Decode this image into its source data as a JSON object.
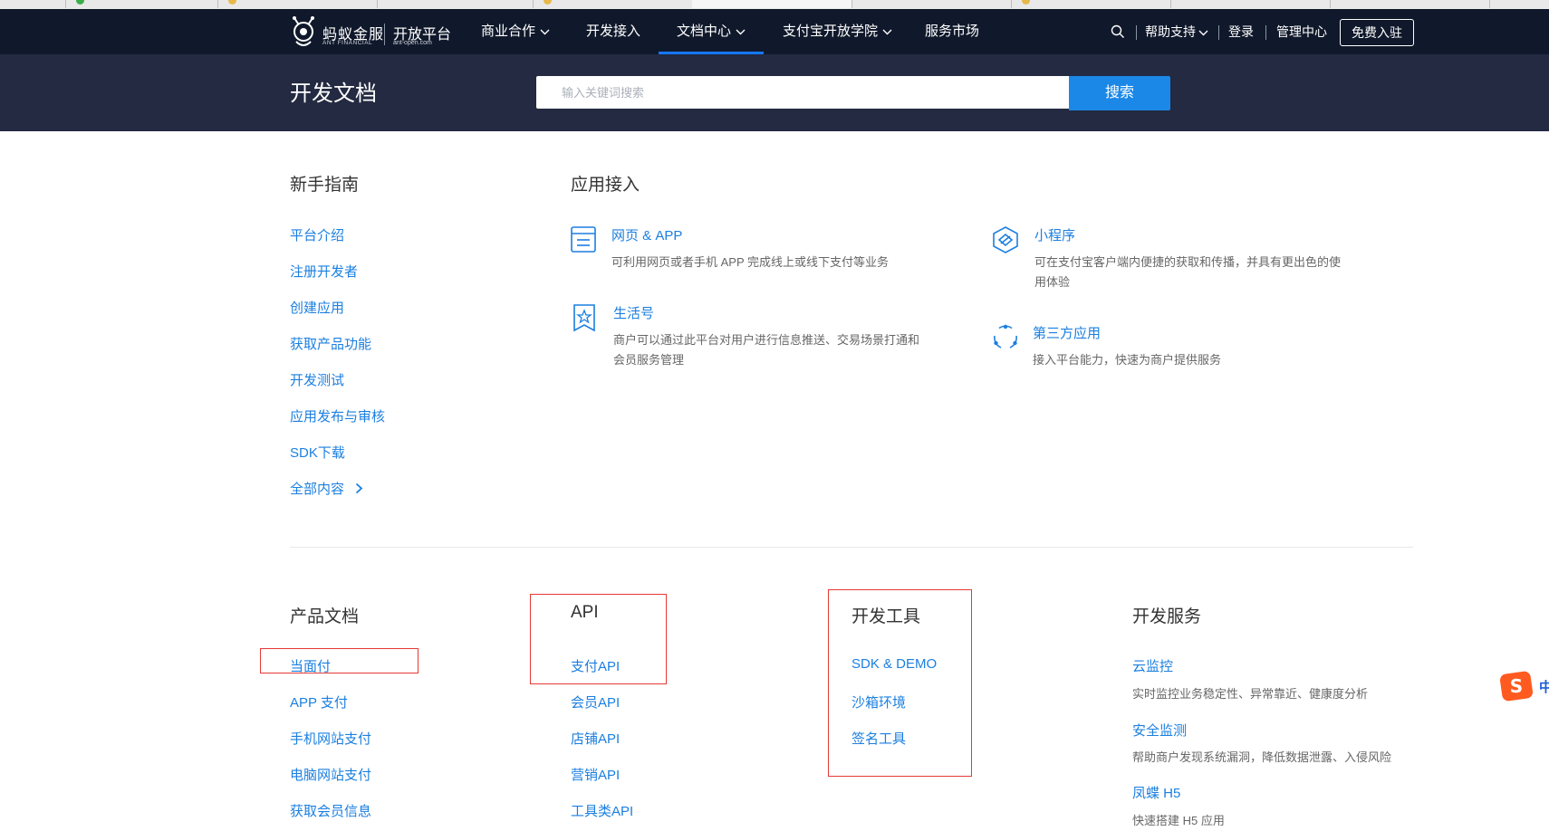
{
  "nav": {
    "brand": "蚂蚁金服",
    "brand_sub": "ANT FINANCIAL",
    "platform": "开放平台",
    "platform_sub": "ant-open.com",
    "items": [
      {
        "label": "商业合作",
        "chevron": true
      },
      {
        "label": "开发接入",
        "chevron": false
      },
      {
        "label": "文档中心",
        "chevron": true,
        "active": true
      },
      {
        "label": "支付宝开放学院",
        "chevron": true
      },
      {
        "label": "服务市场",
        "chevron": false
      }
    ],
    "help": "帮助支持",
    "login": "登录",
    "admin": "管理中心",
    "join": "免费入驻"
  },
  "hero": {
    "title": "开发文档",
    "search_placeholder": "输入关键词搜索",
    "search_button": "搜索"
  },
  "guide": {
    "title": "新手指南",
    "links": [
      "平台介绍",
      "注册开发者",
      "创建应用",
      "获取产品功能",
      "开发测试",
      "应用发布与审核",
      "SDK下载",
      "全部内容"
    ]
  },
  "app_access": {
    "title": "应用接入",
    "cards": [
      {
        "icon": "browser-window-icon",
        "title": "网页 & APP",
        "desc": "可利用网页或者手机 APP 完成线上或线下支付等业务"
      },
      {
        "icon": "mini-program-icon",
        "title": "小程序",
        "desc": "可在支付宝客户端内便捷的获取和传播，并具有更出色的使用体验"
      },
      {
        "icon": "star-bookmark-icon",
        "title": "生活号",
        "desc": "商户可以通过此平台对用户进行信息推送、交易场景打通和会员服务管理"
      },
      {
        "icon": "third-party-icon",
        "title": "第三方应用",
        "desc": "接入平台能力，快速为商户提供服务"
      }
    ]
  },
  "products": {
    "title": "产品文档",
    "links": [
      "当面付",
      "APP 支付",
      "手机网站支付",
      "电脑网站支付",
      "获取会员信息"
    ]
  },
  "api": {
    "title": "API",
    "links": [
      "支付API",
      "会员API",
      "店铺API",
      "营销API",
      "工具类API"
    ]
  },
  "tools": {
    "title": "开发工具",
    "links": [
      "SDK & DEMO",
      "沙箱环境",
      "签名工具"
    ]
  },
  "services": {
    "title": "开发服务",
    "items": [
      {
        "title": "云监控",
        "desc": "实时监控业务稳定性、异常靠近、健康度分析"
      },
      {
        "title": "安全监测",
        "desc": "帮助商户发现系统漏洞，降低数据泄露、入侵风险"
      },
      {
        "title": "凤蝶 H5",
        "desc": "快速搭建 H5 应用"
      }
    ]
  },
  "colors": {
    "nav_bg": "#10192b",
    "hero_bg": "#232a41",
    "link": "#1b7fe0",
    "accent": "#1b88e8",
    "annotation": "#e53935"
  }
}
